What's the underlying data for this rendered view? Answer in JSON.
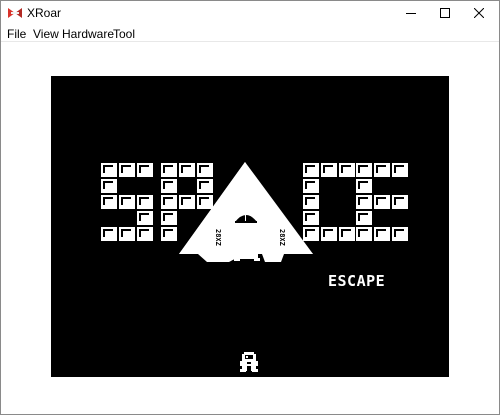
{
  "window": {
    "title": "XRoar",
    "icons": {
      "app": "xroar-app-icon",
      "minimize": "minimize-icon",
      "maximize": "maximize-icon",
      "close": "close-icon"
    }
  },
  "menu": {
    "items": [
      "File",
      "View",
      "Hardware",
      "Tool"
    ]
  },
  "game": {
    "title_word": "SPACE",
    "subtitle": "ESCAPE",
    "ship_label_left": "28XZ",
    "ship_label_right": "28XZ",
    "colors": {
      "screen": "#000000",
      "sprite": "#ffffff"
    }
  }
}
